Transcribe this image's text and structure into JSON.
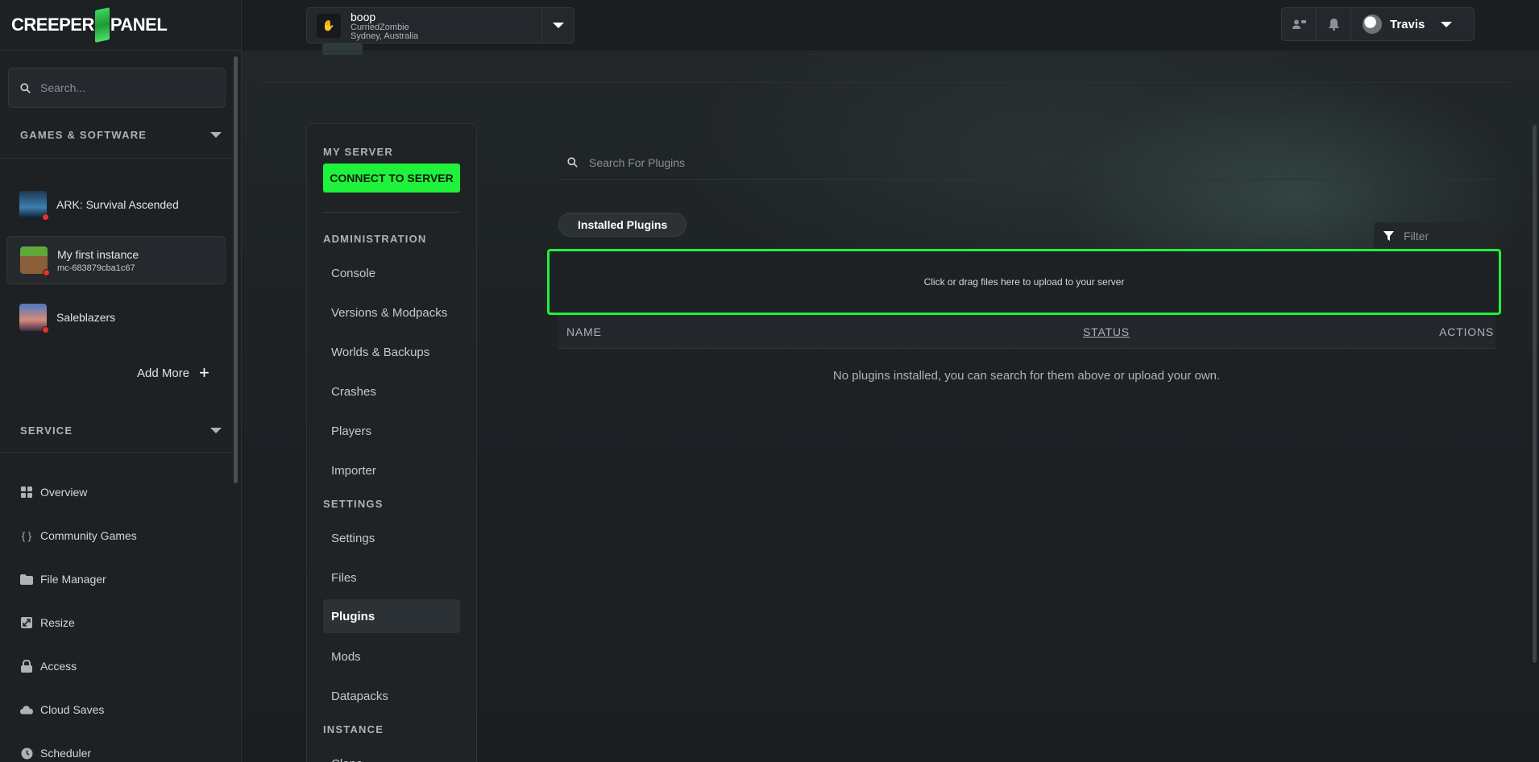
{
  "brand": {
    "logo_left": "CREEPER",
    "logo_right": "PANEL"
  },
  "sidebar": {
    "search_placeholder": "Search...",
    "games_section": "GAMES & SOFTWARE",
    "games": [
      {
        "name": "ARK: Survival Ascended",
        "sub": ""
      },
      {
        "name": "My first instance",
        "sub": "mc-683879cba1c67"
      },
      {
        "name": "Saleblazers",
        "sub": ""
      }
    ],
    "add_more": "Add More",
    "service_section": "SERVICE",
    "service_items": [
      {
        "label": "Overview",
        "icon": "grid-icon"
      },
      {
        "label": "Community Games",
        "icon": "braces-icon"
      },
      {
        "label": "File Manager",
        "icon": "folder-icon"
      },
      {
        "label": "Resize",
        "icon": "resize-icon"
      },
      {
        "label": "Access",
        "icon": "lock-icon"
      },
      {
        "label": "Cloud Saves",
        "icon": "cloud-icon"
      },
      {
        "label": "Scheduler",
        "icon": "clock-icon"
      }
    ]
  },
  "topbar": {
    "server_name": "boop",
    "server_owner": "CurriedZombie",
    "server_location": "Sydney, Australia",
    "user_name": "Travis"
  },
  "server_menu": {
    "my_server": "MY SERVER",
    "connect_button": "CONNECT TO SERVER",
    "administration": "ADMINISTRATION",
    "admin_items": [
      "Console",
      "Versions & Modpacks",
      "Worlds & Backups",
      "Crashes",
      "Players",
      "Importer"
    ],
    "settings": "SETTINGS",
    "settings_items": [
      "Settings",
      "Files",
      "Plugins",
      "Mods",
      "Datapacks"
    ],
    "instance": "INSTANCE",
    "instance_items": [
      "Clone"
    ]
  },
  "plugins": {
    "search_placeholder": "Search For Plugins",
    "tab_installed": "Installed Plugins",
    "filter_placeholder": "Filter",
    "dropzone_text": "Click or drag files here to upload to your server",
    "columns": {
      "name": "NAME",
      "status": "STATUS",
      "actions": "ACTIONS"
    },
    "empty_message": "No plugins installed, you can search for them above or upload your own."
  },
  "colors": {
    "accent": "#1ff23a",
    "status_dot": "#e8332b",
    "background": "#1b1e21"
  }
}
